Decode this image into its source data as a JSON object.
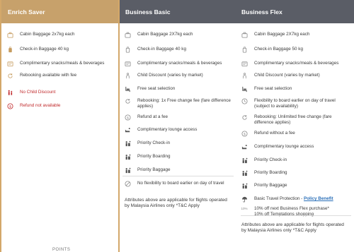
{
  "columns": [
    {
      "title": "Enrich Saver",
      "features": [
        {
          "icon": "baggage-icon",
          "text": "Cabin Baggage 2x7kg each",
          "color": "#c69c5f"
        },
        {
          "icon": "checkin-bag-icon",
          "text": "Check-in Baggage 40 kg",
          "color": "#c69c5f"
        },
        {
          "icon": "snacks-icon",
          "text": "Complimentary snacks/meals & beverages",
          "color": "#c69c5f"
        },
        {
          "icon": "rebook-icon",
          "text": "Rebooking available with fee",
          "color": "#c69c5f"
        },
        {
          "icon": "no-child-icon",
          "text": "No Child Discount",
          "color": "#c0292b"
        },
        {
          "icon": "no-refund-icon",
          "text": "Refund not available",
          "color": "#c0292b"
        }
      ],
      "footer": "POINTS"
    },
    {
      "title": "Business Basic",
      "features": [
        {
          "icon": "baggage-icon",
          "text": "Cabin Baggage 2X7kg each"
        },
        {
          "icon": "checkin-bag-icon",
          "text": "Check-in Baggage 40 kg"
        },
        {
          "icon": "snacks-icon",
          "text": "Complimentary snacks/meals & beverages"
        },
        {
          "icon": "child-icon",
          "text": "Child Discount (varies by market)"
        },
        {
          "icon": "seat-icon",
          "text": "Free seat selection"
        },
        {
          "icon": "rebook-icon",
          "text": "Rebooking: 1x Free change fee (fare difference applies)"
        },
        {
          "icon": "refund-icon",
          "text": "Refund at a fee"
        },
        {
          "icon": "lounge-icon",
          "text": "Complimentary lounge access"
        },
        {
          "icon": "priority-icon",
          "text": "Priority Check-in"
        },
        {
          "icon": "priority-icon",
          "text": "Priority Boarding"
        },
        {
          "icon": "priority-icon",
          "text": "Priority Baggage"
        },
        {
          "icon": "no-flex-icon",
          "text": "No flexibility to board earlier on day of travel"
        }
      ],
      "note": "Attributes above are applicable for flights operated by Malaysia Airlines only *T&C Apply"
    },
    {
      "title": "Business Flex",
      "features": [
        {
          "icon": "baggage-icon",
          "text": "Cabin Baggage 2X7kg each"
        },
        {
          "icon": "checkin-bag-icon",
          "text": "Check-in Baggage 50 kg"
        },
        {
          "icon": "snacks-icon",
          "text": "Complimentary snacks/meals & beverages"
        },
        {
          "icon": "child-icon",
          "text": "Child Discount (varies by market)"
        },
        {
          "icon": "seat-icon",
          "text": "Free seat selection"
        },
        {
          "icon": "clock-icon",
          "text": "Flexibility to board earlier on day of travel (subject to availability)"
        },
        {
          "icon": "rebook-icon",
          "text": "Rebooking: Unlimited free change (fare difference applies)"
        },
        {
          "icon": "refund-icon",
          "text": "Refund without a fee"
        },
        {
          "icon": "lounge-icon",
          "text": "Complimentary lounge access"
        },
        {
          "icon": "priority-icon",
          "text": "Priority Check-in"
        },
        {
          "icon": "priority-icon",
          "text": "Priority Boarding"
        },
        {
          "icon": "priority-icon",
          "text": "Priority Baggage"
        },
        {
          "icon": "umbrella-icon",
          "text": "Basic Travel Protection - ",
          "link": "Policy Benefit"
        },
        {
          "icon": "percent-icon",
          "icon_text": "10%",
          "text": "10% off next Business Flex purchase*",
          "text2": "10% off Temptations shopping"
        }
      ],
      "note": "Attributes above are applicable for flights operated by Malaysia Airlines only *T&C Apply"
    }
  ],
  "colors": {
    "saver_header": "#c7a16b",
    "business_header": "#5a5d66",
    "saver_border": "#d3a86a",
    "icon_gold": "#c69c5f",
    "icon_gray": "#8a8a8a",
    "red": "#c0292b",
    "link": "#2a6fb8"
  }
}
